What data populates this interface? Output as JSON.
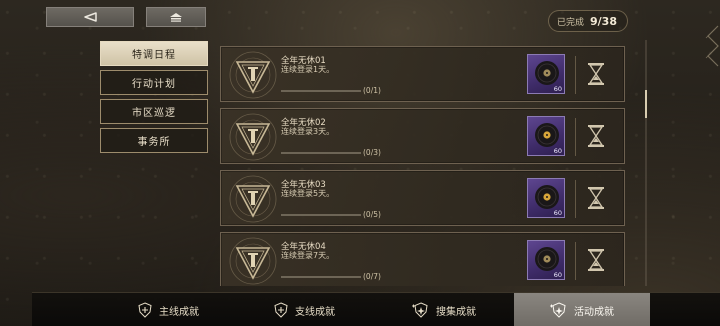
{
  "header": {
    "back_icon": "back-arrow-icon",
    "home_icon": "home-icon",
    "progress_label": "已完成",
    "progress_value": "9/38"
  },
  "side_menu": {
    "items": [
      {
        "label": "特调日程",
        "active": true
      },
      {
        "label": "行动计划",
        "active": false
      },
      {
        "label": "市区巡逻",
        "active": false
      },
      {
        "label": "事务所",
        "active": false
      }
    ]
  },
  "achievements": [
    {
      "title": "全年无休01",
      "desc": "连续登录1天。",
      "progress": "(0/1)",
      "ratio": 0,
      "reward_qty": "60",
      "status_icon": "hourglass-icon"
    },
    {
      "title": "全年无休02",
      "desc": "连续登录3天。",
      "progress": "(0/3)",
      "ratio": 0,
      "reward_qty": "60",
      "status_icon": "hourglass-icon"
    },
    {
      "title": "全年无休03",
      "desc": "连续登录5天。",
      "progress": "(0/5)",
      "ratio": 0,
      "reward_qty": "60",
      "status_icon": "hourglass-icon"
    },
    {
      "title": "全年无休04",
      "desc": "连续登录7天。",
      "progress": "(0/7)",
      "ratio": 0,
      "reward_qty": "60",
      "status_icon": "hourglass-icon"
    }
  ],
  "tabs": [
    {
      "label": "主线成就",
      "icon": "shield-plus-icon",
      "active": false
    },
    {
      "label": "支线成就",
      "icon": "shield-plus-icon",
      "active": false
    },
    {
      "label": "搜集成就",
      "icon": "sparkle-shield-icon",
      "active": false
    },
    {
      "label": "活动成就",
      "icon": "sparkle-shield-icon",
      "active": true
    }
  ],
  "colors": {
    "accent_gold": "#d9c69a",
    "reward_purple": "#4a3578",
    "active_tab": "#7c7872"
  }
}
